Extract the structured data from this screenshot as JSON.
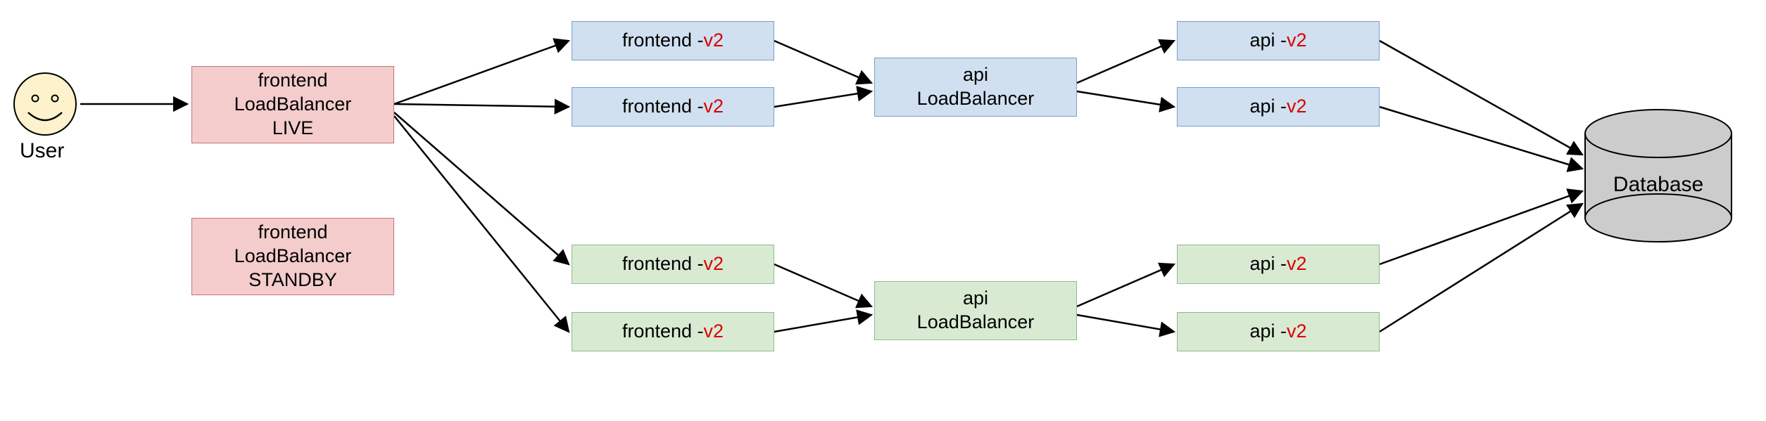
{
  "user": {
    "label": "User"
  },
  "lb_live": {
    "line1": "frontend",
    "line2": "LoadBalancer",
    "line3": "LIVE"
  },
  "lb_standby": {
    "line1": "frontend",
    "line2": "LoadBalancer",
    "line3": "STANDBY"
  },
  "fe_blue_1": {
    "label": "frontend - ",
    "ver": "v2"
  },
  "fe_blue_2": {
    "label": "frontend - ",
    "ver": "v2"
  },
  "fe_green_1": {
    "label": "frontend - ",
    "ver": "v2"
  },
  "fe_green_2": {
    "label": "frontend - ",
    "ver": "v2"
  },
  "api_lb_blue": {
    "line1": "api",
    "line2": "LoadBalancer"
  },
  "api_lb_green": {
    "line1": "api",
    "line2": "LoadBalancer"
  },
  "api_blue_1": {
    "label": "api - ",
    "ver": "v2"
  },
  "api_blue_2": {
    "label": "api - ",
    "ver": "v2"
  },
  "api_green_1": {
    "label": "api - ",
    "ver": "v2"
  },
  "api_green_2": {
    "label": "api - ",
    "ver": "v2"
  },
  "database": {
    "label": "Database"
  },
  "colors": {
    "red_bg": "#f4cccc",
    "blue_bg": "#d0e0f0",
    "green_bg": "#d9ead3",
    "db_bg": "#cccccc",
    "version_text": "#d90000"
  }
}
